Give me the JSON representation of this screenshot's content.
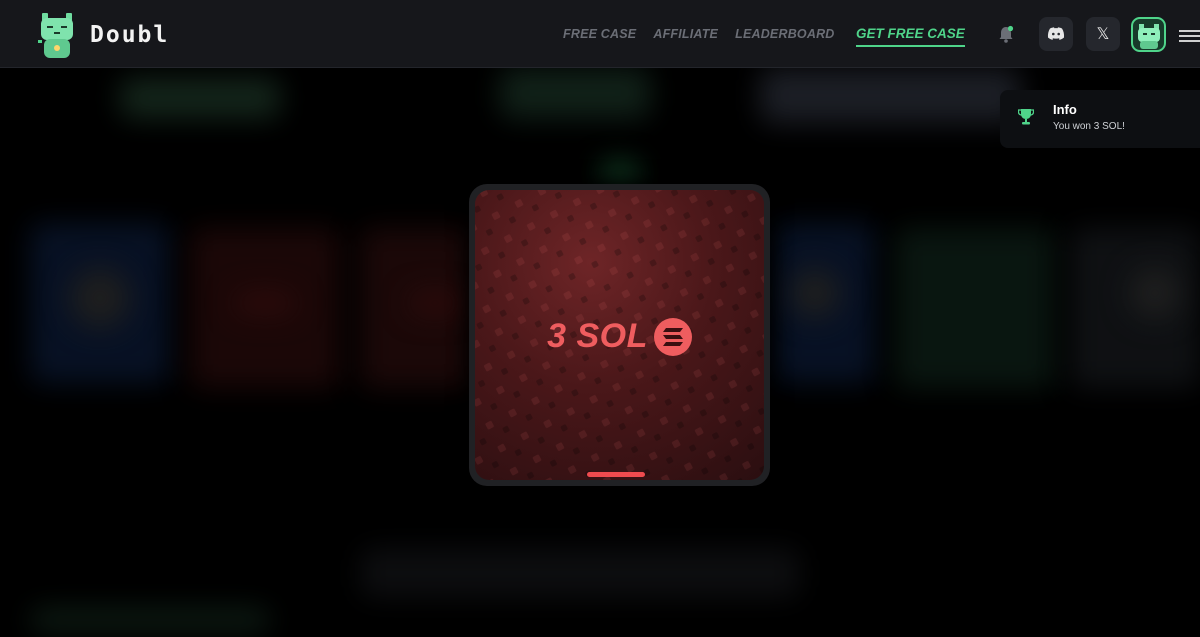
{
  "brand": {
    "name": "Doubl"
  },
  "nav": {
    "items": [
      "FREE CASE",
      "AFFILIATE",
      "LEADERBOARD"
    ],
    "cta": "GET FREE CASE"
  },
  "icons": {
    "notifications": "bell-icon",
    "discord": "discord-icon",
    "x": "x-icon",
    "avatar": "cat-avatar-icon",
    "menu": "hamburger-menu-icon",
    "x_glyph": "𝕏"
  },
  "toast": {
    "title": "Info",
    "message": "You won 3 SOL!",
    "icon": "trophy-icon"
  },
  "prize": {
    "amount": "3 SOL",
    "token_icon": "solana-icon"
  },
  "colors": {
    "accent": "#4fd48a",
    "prize": "#ef5d5f",
    "header_bg": "#16171b"
  }
}
